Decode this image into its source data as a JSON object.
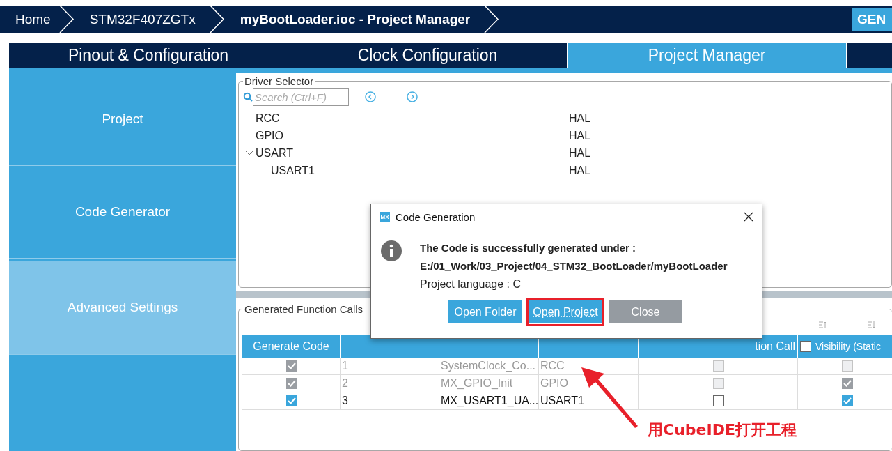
{
  "breadcrumb": [
    {
      "label": "Home",
      "current": false
    },
    {
      "label": "STM32F407ZGTx",
      "current": false
    },
    {
      "label": "myBootLoader.ioc - Project Manager",
      "current": true
    }
  ],
  "generate_button": "GEN",
  "tabs": [
    {
      "label": "Pinout & Configuration",
      "selected": false
    },
    {
      "label": "Clock Configuration",
      "selected": false
    },
    {
      "label": "Project Manager",
      "selected": true
    }
  ],
  "sidebar": {
    "items": [
      {
        "label": "Project",
        "selected": false
      },
      {
        "label": "Code Generator",
        "selected": false
      },
      {
        "label": "Advanced Settings",
        "selected": true
      }
    ]
  },
  "driver_selector": {
    "title": "Driver Selector",
    "search": {
      "placeholder": "Search (Ctrl+F)"
    },
    "items": [
      {
        "name": "RCC",
        "driver": "HAL"
      },
      {
        "name": "GPIO",
        "driver": "HAL"
      },
      {
        "name": "USART",
        "driver": "HAL",
        "expanded": true,
        "children": [
          {
            "name": "USART1",
            "driver": "HAL"
          }
        ]
      }
    ]
  },
  "function_calls": {
    "title": "Generated Function Calls",
    "columns": [
      {
        "label": "Generate Code"
      },
      {},
      {},
      {},
      {
        "label": "tion Call"
      },
      {
        "label": "Visibility (Static",
        "checked": false
      }
    ],
    "rows": [
      {
        "generate": true,
        "disabled": true,
        "rank": "1",
        "function": "SystemClock_Co...",
        "peripheral": "RCC",
        "no_call": false,
        "no_call_disabled": true,
        "visibility": false,
        "visibility_disabled": true
      },
      {
        "generate": true,
        "disabled": true,
        "rank": "2",
        "function": "MX_GPIO_Init",
        "peripheral": "GPIO",
        "no_call": false,
        "no_call_disabled": true,
        "visibility": true,
        "visibility_disabled": true
      },
      {
        "generate": true,
        "disabled": false,
        "rank": "3",
        "function": "MX_USART1_UA...",
        "peripheral": "USART1",
        "no_call": false,
        "no_call_disabled": false,
        "visibility": true,
        "visibility_disabled": false
      }
    ]
  },
  "dialog": {
    "logo": "MX",
    "title": "Code Generation",
    "message": "The Code is successfully generated under :",
    "path": "E:/01_Work/03_Project/04_STM32_BootLoader/myBootLoader",
    "language": "Project language : C",
    "buttons": [
      {
        "label": "Open Folder",
        "kind": "primary",
        "highlighted": false
      },
      {
        "label": "Open Project",
        "kind": "primary",
        "highlighted": true
      },
      {
        "label": "Close",
        "kind": "secondary",
        "highlighted": false
      }
    ]
  },
  "annotation": {
    "text": "用CubeIDE打开工程"
  }
}
